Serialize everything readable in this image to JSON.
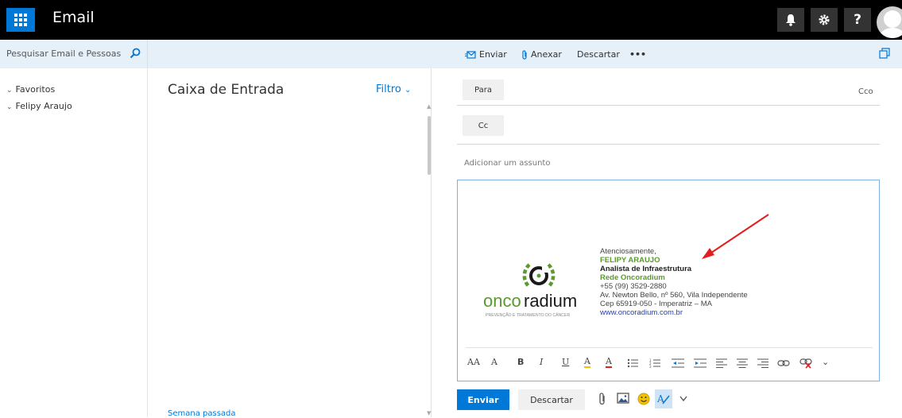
{
  "app": {
    "title": "Email"
  },
  "search": {
    "placeholder": "Pesquisar Email e Pessoas"
  },
  "commands": {
    "send": "Enviar",
    "attach": "Anexar",
    "discard": "Descartar",
    "more": "•••"
  },
  "nav": {
    "items": [
      {
        "label": "Favoritos"
      },
      {
        "label": "Felipy Araujo"
      }
    ]
  },
  "inbox": {
    "title": "Caixa de Entrada",
    "filter": "Filtro",
    "group_label": "Semana passada"
  },
  "compose": {
    "to_label": "Para",
    "cc_label": "Cc",
    "bcc_label": "Cco",
    "subject_placeholder": "Adicionar um assunto",
    "send_label": "Enviar",
    "discard_label": "Descartar"
  },
  "signature": {
    "greeting": "Atenciosamente,",
    "name": "FELIPY ARAUJO",
    "role": "Analista de Infraestrutura",
    "company": "Rede Oncoradium",
    "phone": "+55 (99) 3529-2880",
    "address": "Av. Newton Bello, nº 560, Vila Independente",
    "cep": "Cep 65919-050 - Imperatriz – MA",
    "website": "www.oncoradium.com.br",
    "logo_word_1": "onco",
    "logo_word_2": "radium",
    "logo_tagline": "PREVENÇÃO E TRATAMENTO DO CÂNCER"
  },
  "format_toolbar": {
    "font_size_down": "AA",
    "font_size_up": "A",
    "bold": "B",
    "italic": "I",
    "underline": "U",
    "highlight": "A",
    "font_color": "A",
    "more": "⌄"
  },
  "colors": {
    "accent": "#0078d7",
    "brand_green": "#5a9a2e",
    "topbar": "#000000",
    "cmdbar": "#e6f0f9"
  }
}
